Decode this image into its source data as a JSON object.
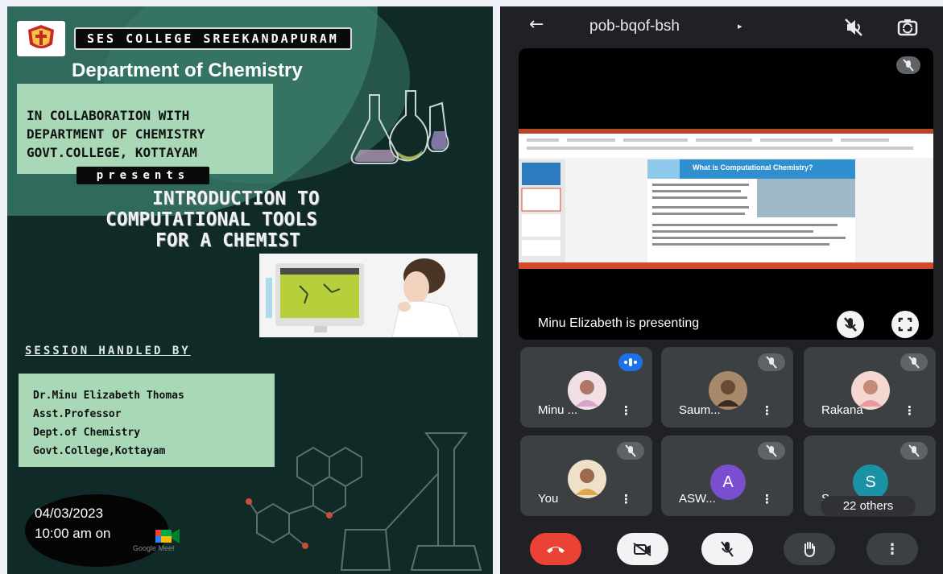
{
  "poster": {
    "college": "SES COLLEGE SREEKANDAPURAM",
    "department": "Department of Chemistry",
    "collaboration_lines": [
      "IN COLLABORATION WITH",
      "DEPARTMENT OF CHEMISTRY",
      "GOVT.COLLEGE, KOTTAYAM"
    ],
    "presents": "presents",
    "title_lines": [
      "INTRODUCTION TO",
      "COMPUTATIONAL TOOLS",
      "FOR A CHEMIST"
    ],
    "session_heading": "SESSION HANDLED BY",
    "speaker_lines": [
      "Dr.Minu Elizabeth Thomas",
      "Asst.Professor",
      "Dept.of Chemistry",
      "Govt.College,Kottayam"
    ],
    "date": "04/03/2023",
    "time": "10:00 am on",
    "platform_label": "Google Meet"
  },
  "meet": {
    "meeting_code": "pob-bqof-bsh",
    "presenting_text": "Minu Elizabeth is presenting",
    "slide_title": "What is Computational Chemistry?",
    "participants": [
      {
        "name": "Minu ...",
        "avatar": "photo",
        "state": "speaking"
      },
      {
        "name": "Saum...",
        "avatar": "photo",
        "state": "muted"
      },
      {
        "name": "Rakana",
        "avatar": "photo",
        "state": "muted"
      },
      {
        "name": "You",
        "avatar": "photo",
        "state": "muted"
      },
      {
        "name": "ASW...",
        "avatar": "letter",
        "letter": "A",
        "color": "#7a4fcf",
        "state": "muted"
      },
      {
        "name": "S",
        "avatar": "letter",
        "letter": "S",
        "color": "#1a93a6",
        "state": "muted"
      }
    ],
    "others_badge": "22 others",
    "colors": {
      "end_call": "#ea4335",
      "surface": "#3c4043",
      "background": "#202124"
    },
    "icons": [
      "back-arrow-icon",
      "speaker-off-icon",
      "switch-camera-icon",
      "mic-off-icon",
      "fullscreen-icon",
      "end-call-icon",
      "camera-off-icon",
      "raise-hand-icon",
      "more-options-icon"
    ]
  }
}
